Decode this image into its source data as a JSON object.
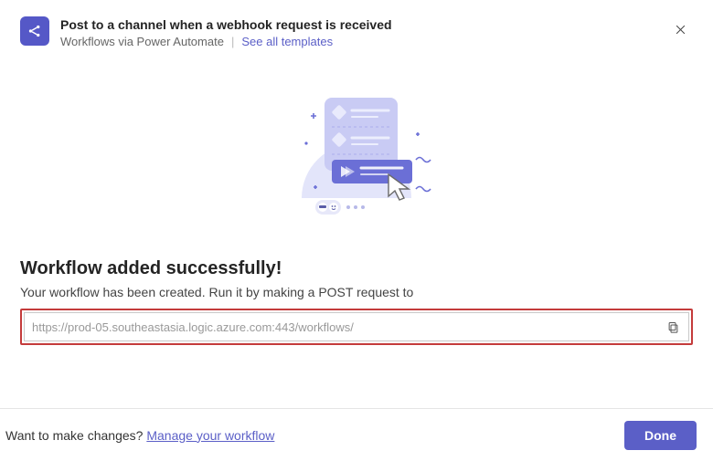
{
  "header": {
    "title": "Post to a channel when a webhook request is received",
    "subtitle": "Workflows via Power Automate",
    "see_all": "See all templates"
  },
  "content": {
    "success_title": "Workflow added successfully!",
    "success_desc": "Your workflow has been created. Run it by making a POST request to",
    "url_value": "https://prod-05.southeastasia.logic.azure.com:443/workflows/"
  },
  "footer": {
    "changes_text": "Want to make changes? ",
    "manage_link": "Manage your workflow",
    "done_label": "Done"
  },
  "icons": {
    "app": "share-icon",
    "close": "close-icon",
    "copy": "copy-icon"
  },
  "colors": {
    "accent": "#5b5fc7",
    "highlight_border": "#c43b3b"
  }
}
